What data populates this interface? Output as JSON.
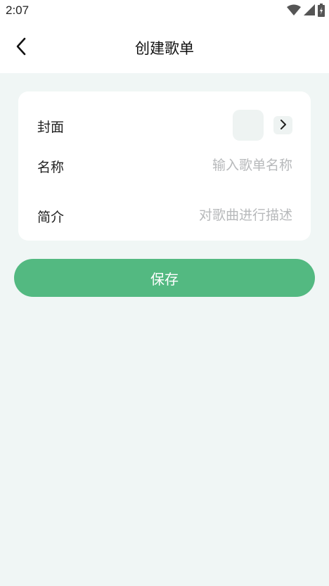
{
  "status_bar": {
    "time": "2:07",
    "icons": [
      "wifi-icon",
      "signal-icon",
      "battery-icon"
    ]
  },
  "header": {
    "back_icon": "chevron-left-icon",
    "title": "创建歌单"
  },
  "form": {
    "cover": {
      "label": "封面",
      "arrow_icon": "chevron-right-icon"
    },
    "name": {
      "label": "名称",
      "value": "",
      "placeholder": "输入歌单名称"
    },
    "description": {
      "label": "简介",
      "value": "",
      "placeholder": "对歌曲进行描述"
    }
  },
  "save_button": {
    "label": "保存"
  },
  "colors": {
    "primary": "#53b981",
    "background": "#f0f6f5",
    "card": "#ffffff",
    "placeholder": "#b7b9bb"
  }
}
